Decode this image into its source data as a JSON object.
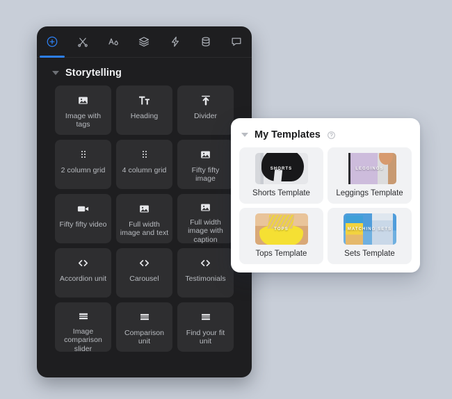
{
  "editor": {
    "tabs": [
      {
        "name": "add",
        "icon": "plus-circle-icon",
        "active": true
      },
      {
        "name": "design",
        "icon": "scissors-icon",
        "active": false
      },
      {
        "name": "typography",
        "icon": "text-style-icon",
        "active": false
      },
      {
        "name": "layers",
        "icon": "layers-icon",
        "active": false
      },
      {
        "name": "actions",
        "icon": "lightning-icon",
        "active": false
      },
      {
        "name": "data",
        "icon": "database-icon",
        "active": false
      },
      {
        "name": "comments",
        "icon": "comment-icon",
        "active": false
      }
    ],
    "section": {
      "title": "Storytelling",
      "expanded": true,
      "blocks": [
        {
          "label": "Image with tags",
          "icon": "image-icon"
        },
        {
          "label": "Heading",
          "icon": "text-heading-icon"
        },
        {
          "label": "Divider",
          "icon": "divider-icon"
        },
        {
          "label": "2 column grid",
          "icon": "grid-dots-icon"
        },
        {
          "label": "4 column grid",
          "icon": "grid-dots-icon"
        },
        {
          "label": "Fifty fifty image",
          "icon": "image-icon"
        },
        {
          "label": "Fifty fifty video",
          "icon": "video-camera-icon"
        },
        {
          "label": "Full width image and text",
          "icon": "image-icon"
        },
        {
          "label": "Full width image with caption",
          "icon": "image-icon"
        },
        {
          "label": "Accordion unit",
          "icon": "code-brackets-icon"
        },
        {
          "label": "Carousel",
          "icon": "code-brackets-icon"
        },
        {
          "label": "Testimonials",
          "icon": "code-brackets-icon"
        },
        {
          "label": "Image comparison slider",
          "icon": "stacked-bars-icon"
        },
        {
          "label": "Comparison unit",
          "icon": "stacked-bars-icon"
        },
        {
          "label": "Find your fit unit",
          "icon": "stacked-bars-icon"
        }
      ]
    }
  },
  "templates": {
    "title": "My Templates",
    "expanded": true,
    "help_icon": "question-circle-icon",
    "items": [
      {
        "label": "Shorts Template",
        "thumb_caption": "SHORTS",
        "thumb_style": "t-shorts",
        "selected": true
      },
      {
        "label": "Leggings Template",
        "thumb_caption": "LEGGINGS",
        "thumb_style": "t-leg",
        "selected": true
      },
      {
        "label": "Tops Template",
        "thumb_caption": "TOPS",
        "thumb_style": "t-tops",
        "selected": true
      },
      {
        "label": "Sets Template",
        "thumb_caption": "MATCHING SETS",
        "thumb_style": "t-sets",
        "selected": true
      }
    ]
  },
  "colors": {
    "page_background": "#c8ced8",
    "panel_background": "#1e1e20",
    "card_background": "#2e2e30",
    "accent": "#2d7ff0",
    "popover_background": "#ffffff"
  }
}
